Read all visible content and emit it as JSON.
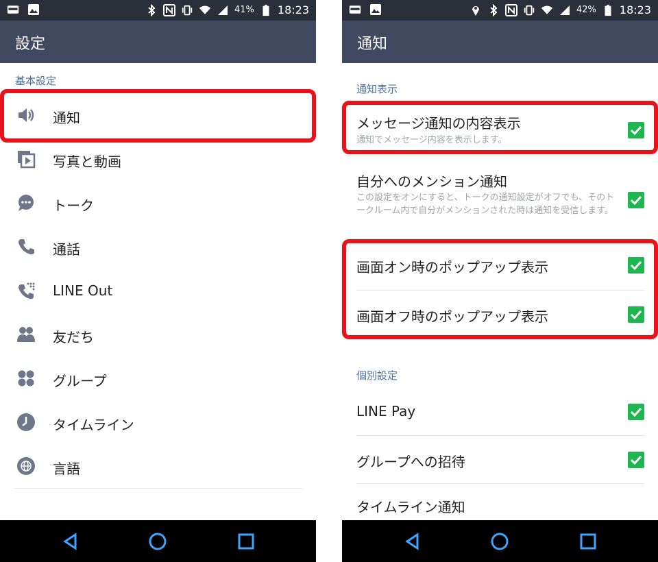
{
  "left_screen": {
    "statusbar": {
      "battery_pct": "41",
      "pct_sign": "%",
      "time": "18:23"
    },
    "title": "設定",
    "section_basic": "基本設定",
    "items": [
      {
        "label": "通知",
        "icon": "speaker-icon"
      },
      {
        "label": "写真と動画",
        "icon": "media-icon"
      },
      {
        "label": "トーク",
        "icon": "chat-bubble-icon"
      },
      {
        "label": "通話",
        "icon": "phone-icon"
      },
      {
        "label": "LINE Out",
        "icon": "line-out-phone-icon"
      },
      {
        "label": "友だち",
        "icon": "friends-icon"
      },
      {
        "label": "グループ",
        "icon": "group-icon"
      },
      {
        "label": "タイムライン",
        "icon": "clock-icon"
      },
      {
        "label": "言語",
        "icon": "globe-icon"
      }
    ]
  },
  "right_screen": {
    "statusbar": {
      "battery_pct": "42",
      "pct_sign": "%",
      "time": "18:23"
    },
    "title": "通知",
    "section_display": "通知表示",
    "section_individual": "個別設定",
    "rows": [
      {
        "title": "メッセージ通知の内容表示",
        "desc": "通知でメッセージ内容を表示します。",
        "checked": true
      },
      {
        "title": "自分へのメンション通知",
        "desc": "この設定をオンにすると、トークの通知設定がオフでも、そのトークルーム内で自分がメンションされた時は通知を受信します。",
        "checked": true
      },
      {
        "title": "画面オン時のポップアップ表示",
        "checked": true
      },
      {
        "title": "画面オフ時のポップアップ表示",
        "checked": true
      },
      {
        "title": "LINE Pay",
        "checked": true
      },
      {
        "title": "グループへの招待",
        "checked": true
      },
      {
        "title": "タイムライン通知"
      }
    ]
  },
  "colors": {
    "statusbar_bg": "#2b2f3a",
    "appbar_bg": "#414960",
    "section_header": "#4a6ea8",
    "highlight": "#e8141b",
    "checkbox_green": "#1fb650"
  }
}
